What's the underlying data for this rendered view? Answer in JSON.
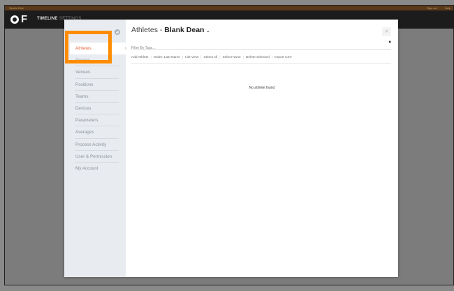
{
  "topbar": {
    "org_name": "Sports Club",
    "right_links": [
      "Sign out",
      "Help"
    ]
  },
  "header": {
    "nav": {
      "timeline": "TIMELINE",
      "settings": "SETTINGS"
    }
  },
  "sidebar": {
    "items": [
      {
        "label": "Athletes",
        "active": true
      },
      {
        "label": "Groups"
      },
      {
        "label": "Venues"
      },
      {
        "label": "Positions"
      },
      {
        "label": "Teams"
      },
      {
        "label": "Devices"
      },
      {
        "label": "Parameters"
      },
      {
        "label": "Averages"
      },
      {
        "label": "Process Activity"
      },
      {
        "label": "User & Permission"
      },
      {
        "label": "My Account"
      }
    ]
  },
  "main": {
    "title_prefix": "Athletes - ",
    "title_name": "Blank Dean",
    "filter_placeholder": "Filter By Tags...",
    "actions": [
      "Add Athlete",
      "Order: Last Name",
      "List View",
      "Select All",
      "Select None",
      "Delete Selected",
      "Import CSV"
    ],
    "empty_message": "No athlete found"
  },
  "colors": {
    "accent": "#e4572e",
    "highlight": "#ff8c00",
    "header_bg": "#1c1c1c"
  }
}
